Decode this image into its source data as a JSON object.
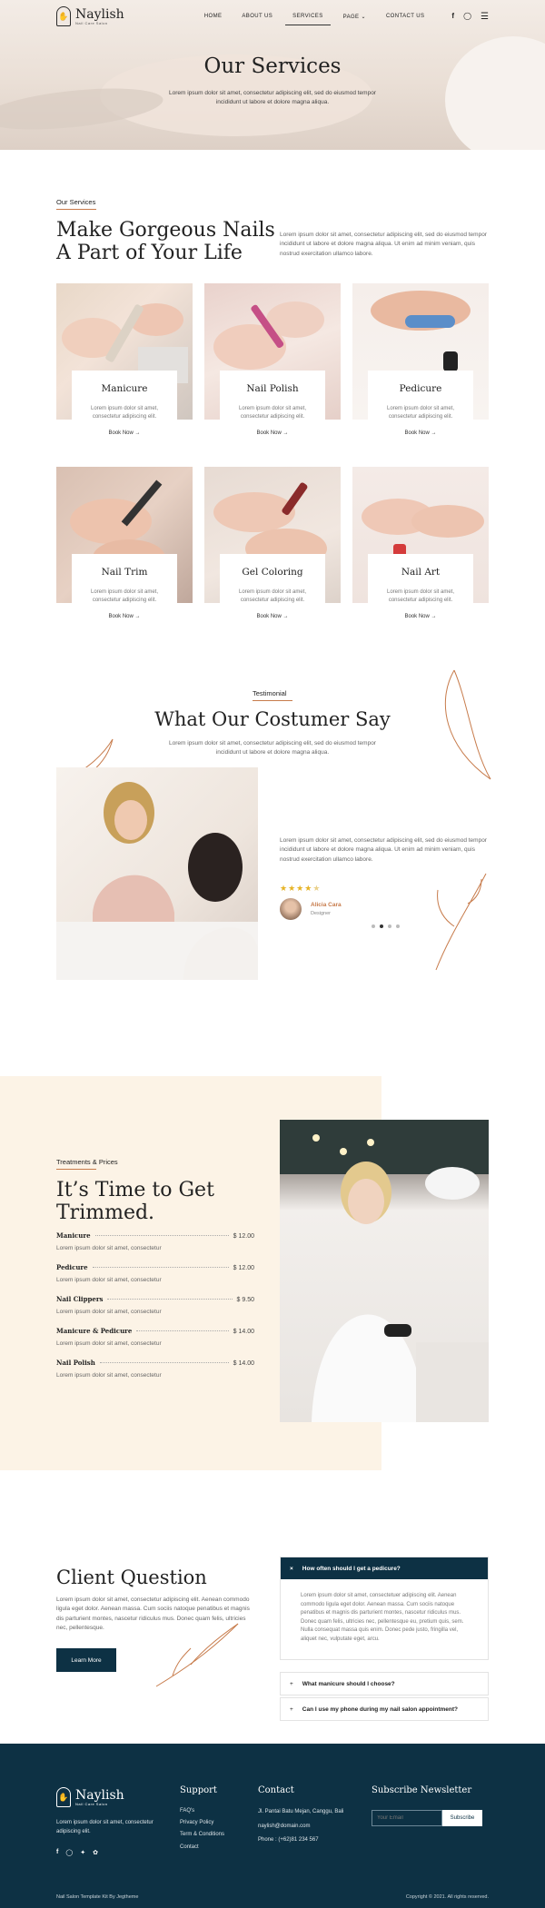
{
  "brand": {
    "name": "Naylish",
    "tagline": "Nail Care Salon"
  },
  "nav": {
    "items": [
      "HOME",
      "ABOUT US",
      "SERVICES",
      "PAGE",
      "CONTACT US"
    ],
    "active": "SERVICES"
  },
  "hero": {
    "title": "Our Services",
    "subtitle_line1": "Lorem ipsum dolor sit amet, consectetur adipiscing elit, sed do eiusmod tempor",
    "subtitle_line2": "incididunt ut labore et dolore magna aliqua."
  },
  "services": {
    "eyebrow": "Our Services",
    "title_line1": "Make Gorgeous Nails",
    "title_line2": "A Part of Your Life",
    "description": "Lorem ipsum dolor sit amet, consectetur adipiscing elit, sed do eiusmod tempor incididunt ut labore et dolore magna aliqua. Ut enim ad minim veniam, quis nostrud exercitation ullamco labore.",
    "card_text_line1": "Lorem ipsum dolor sit amet,",
    "card_text_line2": "consectetur adipiscing elit.",
    "book_label": "Book Now",
    "cards": [
      {
        "name": "Manicure"
      },
      {
        "name": "Nail Polish"
      },
      {
        "name": "Pedicure"
      },
      {
        "name": "Nail Trim"
      },
      {
        "name": "Gel Coloring"
      },
      {
        "name": "Nail Art"
      }
    ]
  },
  "testimonial": {
    "eyebrow": "Testimonial",
    "title": "What Our Costumer Say",
    "subtitle_line1": "Lorem ipsum dolor sit amet, consectetur adipiscing elit, sed do eiusmod tempor",
    "subtitle_line2": "incididunt ut labore et dolore magna aliqua.",
    "quote": "Lorem ipsum dolor sit amet, consectetur adipiscing elit, sed do eiusmod tempor incididunt ut labore et dolore magna aliqua. Ut enim ad minim veniam, quis nostrud exercitation ullamco labore.",
    "rating": 4.5,
    "author_name": "Alicia Cara",
    "author_role": "Designer"
  },
  "prices": {
    "eyebrow": "Treatments & Prices",
    "title_line1": "It’s Time to Get",
    "title_line2": "Trimmed.",
    "item_desc": "Lorem ipsum dolor sit amet, consectetur",
    "items": [
      {
        "name": "Manicure",
        "price": "$ 12.00"
      },
      {
        "name": "Pedicure",
        "price": "$ 12.00"
      },
      {
        "name": "Nail Clippers",
        "price": "$ 9.50"
      },
      {
        "name": "Manicure & Pedicure",
        "price": "$ 14.00"
      },
      {
        "name": "Nail Polish",
        "price": "$ 14.00"
      }
    ]
  },
  "faq": {
    "title": "Client Question",
    "description": "Lorem ipsum dolor sit amet, consectetur adipiscing elit. Aenean commodo ligula eget dolor. Aenean massa. Cum sociis natoque penatibus et magnis dis parturient montes, nascetur ridiculus mus. Donec quam felis, ultricies nec, pellentesque.",
    "button": "Learn More",
    "items": [
      {
        "question": "How often should I get a pedicure?",
        "answer": "Lorem ipsum dolor sit amet, consectetuer adipiscing elit. Aenean commodo ligula eget dolor. Aenean massa. Cum sociis natoque penatibus et magnis dis parturient montes, nascetur ridiculus mus. Donec quam felis, ultricies nec, pellentesque eu, pretium quis, sem. Nulla consequat massa quis enim. Donec pede justo, fringilla vel, aliquet nec, vulputate eget, arcu."
      },
      {
        "question": "What manicure should I choose?"
      },
      {
        "question": "Can I use my phone during my nail salon appointment?"
      }
    ]
  },
  "footer": {
    "about": "Lorem ipsum dolor sit amet, consectetur adipiscing elit.",
    "support_title": "Support",
    "support_links": [
      "FAQ's",
      "Privacy Policy",
      "Term & Conditions",
      "Contact"
    ],
    "contact_title": "Contact",
    "address": "Jl. Pantai Batu Mejan, Canggu, Bali",
    "email": "naylish@domain.com",
    "phone": "Phone : (+62)81 234 567",
    "newsletter_title": "Subscribe Newsletter",
    "email_placeholder": "Your Email",
    "subscribe": "Subscribe",
    "credit": "Nail Salon Template Kit By Jegtheme",
    "copyright": "Copyright © 2021. All rights reserved."
  },
  "colors": {
    "accent": "#c77b4b",
    "navy": "#0d3144",
    "cream": "#fcf3e6"
  }
}
